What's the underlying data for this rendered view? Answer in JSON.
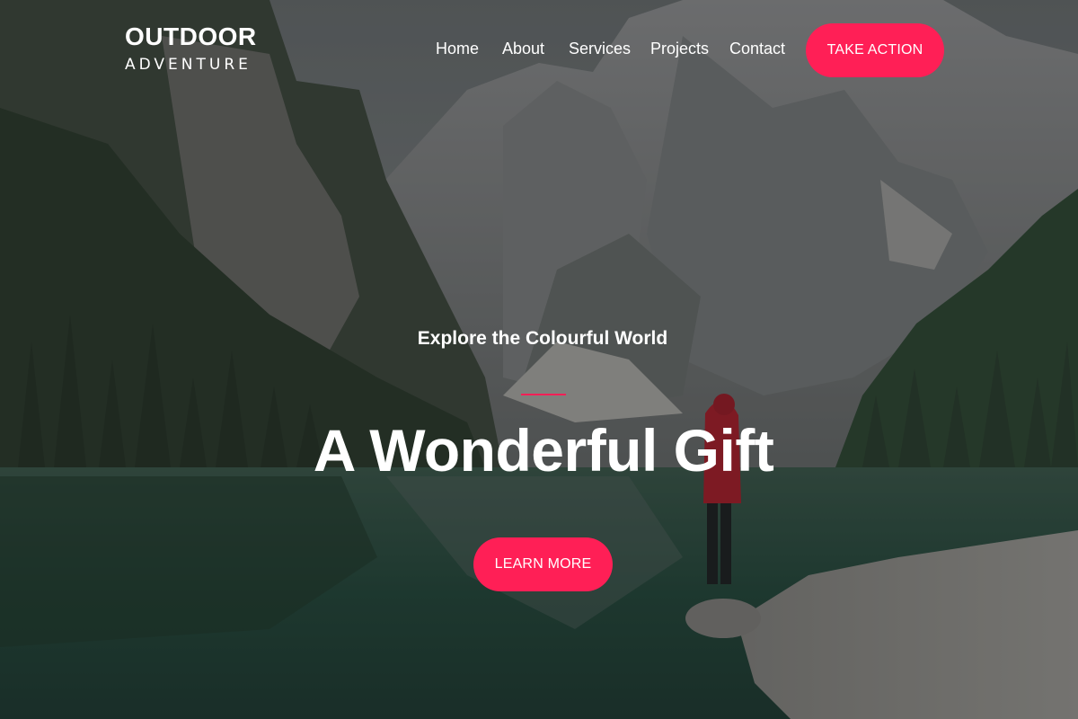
{
  "header": {
    "logo_line1": "OUTDOOR",
    "logo_line2": "ADVENTURE",
    "nav": [
      {
        "label": "Home"
      },
      {
        "label": "About"
      },
      {
        "label": "Services"
      },
      {
        "label": "Projects"
      },
      {
        "label": "Contact"
      }
    ],
    "cta_label": "TAKE ACTION"
  },
  "hero": {
    "subtitle": "Explore the Colourful World",
    "title": "A Wonderful Gift",
    "button_label": "LEARN MORE"
  },
  "colors": {
    "accent": "#ff1f56",
    "text": "#ffffff"
  },
  "background": {
    "description_icon": "mountain-lake-photo"
  }
}
